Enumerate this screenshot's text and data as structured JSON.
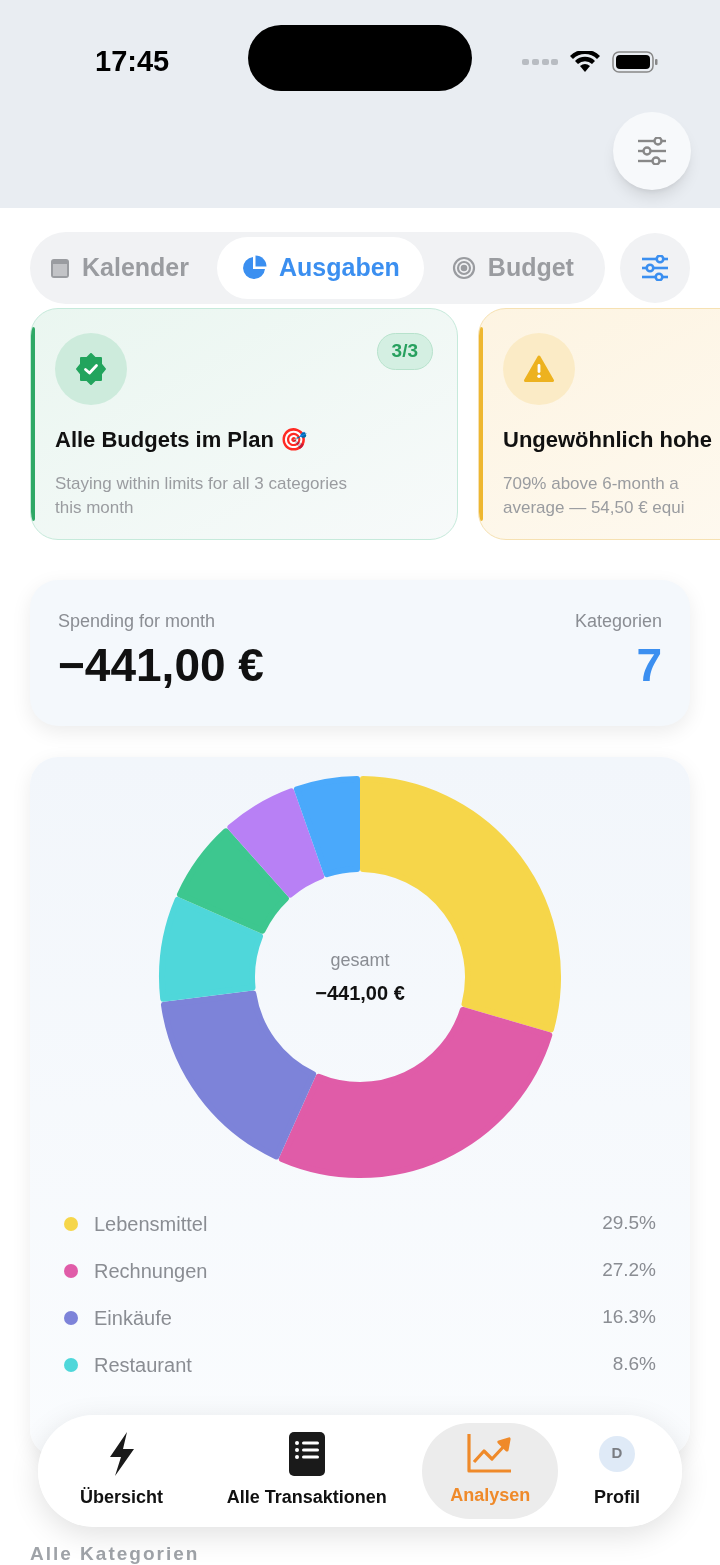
{
  "status_bar": {
    "time": "17:45"
  },
  "tabs": [
    {
      "label": "Kalender",
      "selected": false
    },
    {
      "label": "Ausgaben",
      "selected": true
    },
    {
      "label": "Budget",
      "selected": false
    }
  ],
  "insight_cards": [
    {
      "kind": "success",
      "title": "Alle Budgets im Plan 🎯",
      "badge": "3/3",
      "lines": [
        "Staying within limits for all 3 categories",
        "this month"
      ]
    },
    {
      "kind": "warning",
      "title": "Ungewöhnlich hohe",
      "lines": [
        "709% above 6-month a",
        "average — 54,50 € equi"
      ]
    }
  ],
  "summary": {
    "label": "Spending for month",
    "amount": "−441,00 €",
    "count_label": "Kategorien",
    "count": "7"
  },
  "chart": {
    "center_label": "gesamt",
    "center_value": "−441,00 €",
    "chart_data": {
      "type": "donut",
      "values": [
        29.5,
        27.2,
        16.3,
        8.6,
        6.8,
        6.2,
        5.4
      ],
      "colors": [
        "#f6d64a",
        "#e05ca8",
        "#7d83d9",
        "#4fd7da",
        "#3dc78f",
        "#b880f5",
        "#4aa9fb"
      ]
    },
    "legend": [
      {
        "name": "Lebensmittel",
        "percent": "29.5%",
        "color": "#f6d64a"
      },
      {
        "name": "Rechnungen",
        "percent": "27.2%",
        "color": "#e05ca8"
      },
      {
        "name": "Einkäufe",
        "percent": "16.3%",
        "color": "#7d83d9"
      },
      {
        "name": "Restaurant",
        "percent": "8.6%",
        "color": "#4fd7da"
      }
    ]
  },
  "section_label": "Alle Kategorien",
  "nav": [
    {
      "label": "Übersicht",
      "selected": false
    },
    {
      "label": "Alle Transaktionen",
      "selected": false
    },
    {
      "label": "Analysen",
      "selected": true
    },
    {
      "label": "Profil",
      "avatar": "D",
      "selected": false
    }
  ]
}
